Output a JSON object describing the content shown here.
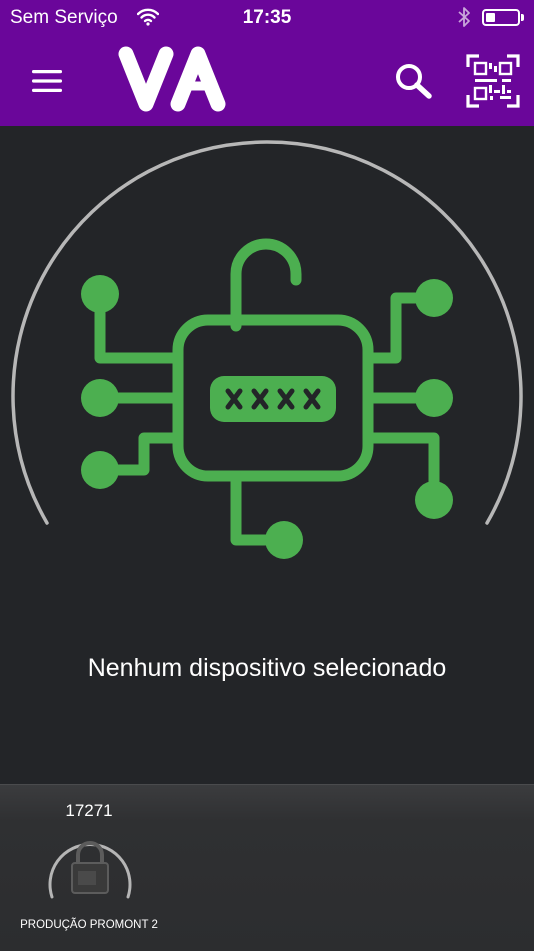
{
  "status_bar": {
    "carrier": "Sem Serviço",
    "time": "17:35",
    "battery_level": 0.3
  },
  "nav": {
    "logo": "VA",
    "menu_icon": "hamburger-menu-icon",
    "search_icon": "search-icon",
    "qr_icon": "qr-code-scan-icon"
  },
  "main": {
    "illustration_icon": "digital-lock-circuit-icon",
    "message": "Nenhum dispositivo selecionado",
    "accent_color": "#4caf50"
  },
  "devices": [
    {
      "id": "17271",
      "name": "PRODUÇÃO PROMONT 2",
      "icon": "padlock-icon"
    }
  ],
  "colors": {
    "brand": "#6a069a",
    "background": "#232528"
  }
}
